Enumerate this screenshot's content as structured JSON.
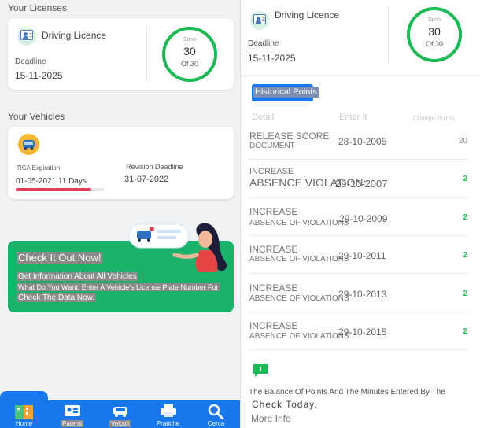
{
  "left": {
    "licenses_title": "Your Licenses",
    "license_card": {
      "title": "Driving Licence",
      "deadline_label": "Deadline",
      "deadline_value": "15-11-2025",
      "ring_label": "Stino",
      "points": "30",
      "points_of": "Of 30"
    },
    "vehicles_title": "Your Vehicles",
    "vehicle_card": {
      "rca_label": "RCA Expiration",
      "rca_value": "01-05-2021 11 Days",
      "rca_progress": 0.86,
      "revision_label": "Revision Deadline",
      "revision_value": "31-07-2022"
    },
    "banner": {
      "title": "Check It Out Now!",
      "line1": "Get Information About All Vehicles",
      "line2": "What Do You Want. Enter A Vehicle's License Plate Number For",
      "line3": "Check The Data Now."
    },
    "nav": [
      {
        "label": "Home",
        "icon": "home-grid-icon"
      },
      {
        "label": "Patenti",
        "icon": "license-card-icon"
      },
      {
        "label": "Veicoli",
        "icon": "car-icon"
      },
      {
        "label": "Pratiche",
        "icon": "printer-icon"
      },
      {
        "label": "Cerca",
        "icon": "search-icon"
      }
    ]
  },
  "right": {
    "license_card": {
      "title": "Driving Licence",
      "deadline_label": "Deadline",
      "deadline_value": "15-11-2025",
      "ring_label": "Stino",
      "points": "30",
      "points_of": "Of 30"
    },
    "historical_button": "Historical Points",
    "columns": [
      "Detail",
      "Enter It",
      "Change Points"
    ],
    "rows": [
      {
        "detail1": "RELEASE SCORE",
        "detail2": "DOCUMENT",
        "date": "28-10-2005",
        "points": "20"
      },
      {
        "detail1": "INCREASE",
        "detail2": "ABSENCE VIOLATION:",
        "date": "29-10-2007",
        "points": "2"
      },
      {
        "detail1": "INCREASE",
        "detail2": "ABSENCE OF VIOLATIONS",
        "date": "29-10-2009",
        "points": "2"
      },
      {
        "detail1": "INCREASE",
        "detail2": "ABSENCE OF VIOLATIONS",
        "date": "29-10-2011",
        "points": "2"
      },
      {
        "detail1": "INCREASE",
        "detail2": "ABSENCE OF VIOLATIONS",
        "date": "29-10-2013",
        "points": "2"
      },
      {
        "detail1": "INCREASE",
        "detail2": "ABSENCE OF VIOLATIONS",
        "date": "29-10-2015",
        "points": "2"
      }
    ],
    "info_text1": "The Balance Of Points And The Minutes Entered By The",
    "info_text2": "Check Today.",
    "more_info": "More Info"
  },
  "colors": {
    "accent_blue": "#1777ec",
    "green": "#1db954",
    "banner_green": "#1bb36b",
    "progress_red": "#e0405a"
  }
}
